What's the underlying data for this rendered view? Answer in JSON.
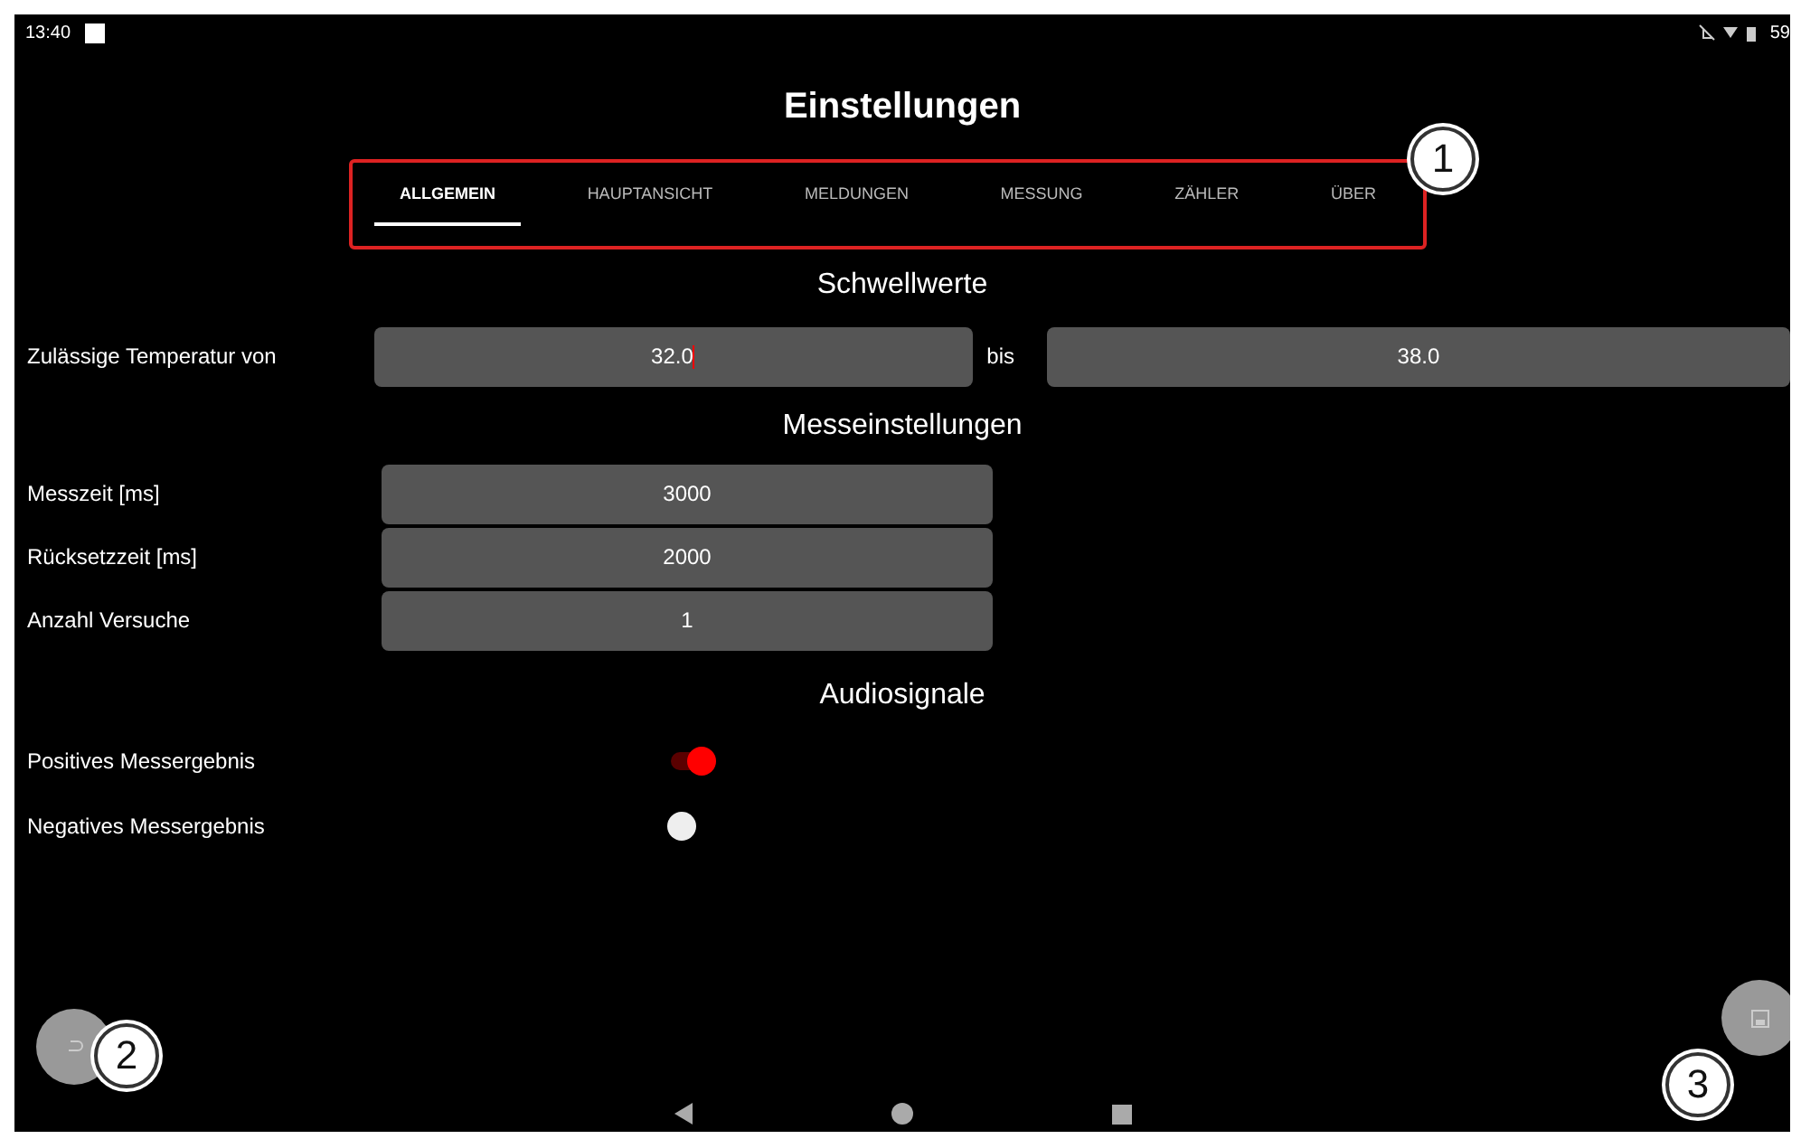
{
  "status_bar": {
    "time": "13:40",
    "battery": "59"
  },
  "title": "Einstellungen",
  "tabs": [
    {
      "label": "ALLGEMEIN",
      "selected": true
    },
    {
      "label": "HAUPTANSICHT",
      "selected": false
    },
    {
      "label": "MELDUNGEN",
      "selected": false
    },
    {
      "label": "MESSUNG",
      "selected": false
    },
    {
      "label": "ZÄHLER",
      "selected": false
    },
    {
      "label": "ÜBER",
      "selected": false
    }
  ],
  "thresholds": {
    "heading": "Schwellwerte",
    "label": "Zulässige Temperatur von",
    "from": {
      "value": "32.0",
      "focused": true
    },
    "separator": "bis",
    "to": {
      "value": "38.0",
      "focused": false
    }
  },
  "measurement": {
    "heading": "Messeinstellungen",
    "rows": [
      {
        "label": "Messzeit [ms]",
        "value": "3000"
      },
      {
        "label": "Rücksetzzeit [ms]",
        "value": "2000"
      },
      {
        "label": "Anzahl Versuche",
        "value": "1"
      }
    ]
  },
  "audio": {
    "heading": "Audiosignale",
    "rows": [
      {
        "label": "Positives Messergebnis",
        "on": true
      },
      {
        "label": "Negatives Messergebnis",
        "on": false
      }
    ]
  },
  "annotations": [
    {
      "label": "1"
    },
    {
      "label": "2"
    },
    {
      "label": "3"
    }
  ]
}
